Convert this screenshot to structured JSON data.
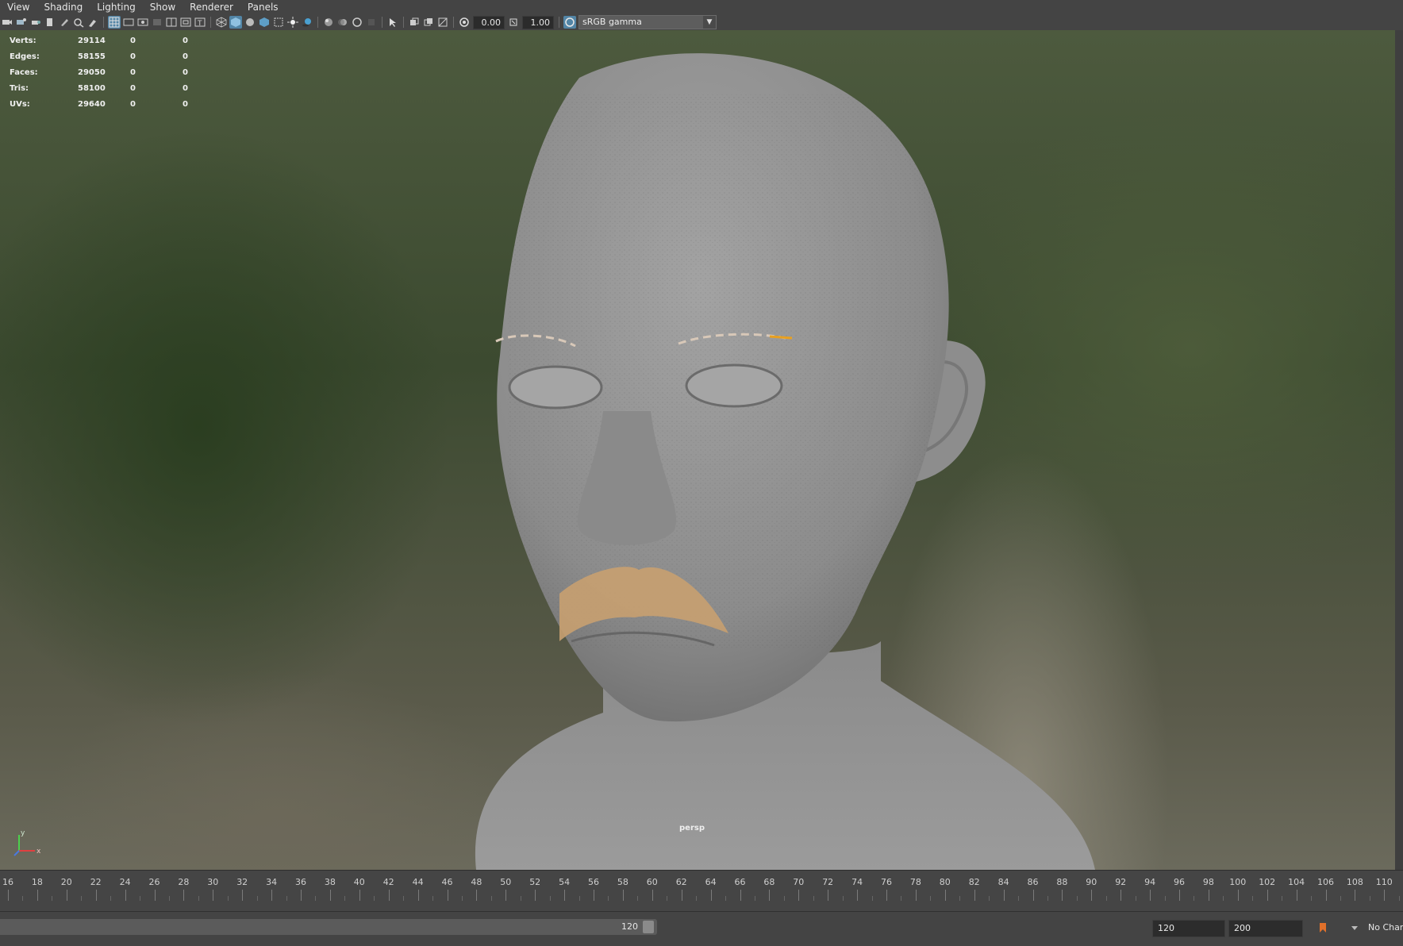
{
  "menu": {
    "items": [
      {
        "label": "View"
      },
      {
        "label": "Shading"
      },
      {
        "label": "Lighting"
      },
      {
        "label": "Show"
      },
      {
        "label": "Renderer"
      },
      {
        "label": "Panels"
      }
    ]
  },
  "toolbar": {
    "exposure_value": "0.00",
    "gamma_value": "1.00",
    "color_space": "sRGB gamma"
  },
  "hud": {
    "rows": [
      {
        "label": "Verts:",
        "v1": "29114",
        "v2": "0",
        "v3": "0"
      },
      {
        "label": "Edges:",
        "v1": "58155",
        "v2": "0",
        "v3": "0"
      },
      {
        "label": "Faces:",
        "v1": "29050",
        "v2": "0",
        "v3": "0"
      },
      {
        "label": "Tris:",
        "v1": "58100",
        "v2": "0",
        "v3": "0"
      },
      {
        "label": "UVs:",
        "v1": "29640",
        "v2": "0",
        "v3": "0"
      }
    ]
  },
  "viewport": {
    "camera_label": "persp",
    "axis_y": "y",
    "axis_x": "x"
  },
  "timeline": {
    "ticks": [
      "16",
      "18",
      "20",
      "22",
      "24",
      "26",
      "28",
      "30",
      "32",
      "34",
      "36",
      "38",
      "40",
      "42",
      "44",
      "46",
      "48",
      "50",
      "52",
      "54",
      "56",
      "58",
      "60",
      "62",
      "64",
      "66",
      "68",
      "70",
      "72",
      "74",
      "76",
      "78",
      "80",
      "82",
      "84",
      "86",
      "88",
      "90",
      "92",
      "94",
      "96",
      "98",
      "100",
      "102",
      "104",
      "106",
      "108",
      "110"
    ]
  },
  "range": {
    "slider_end": "120",
    "end_time": "120",
    "anim_end": "200",
    "character_set": "No Char"
  },
  "colors": {
    "accent": "#5285a6",
    "key_marker": "#e0702a",
    "hair": "#c8a070"
  }
}
